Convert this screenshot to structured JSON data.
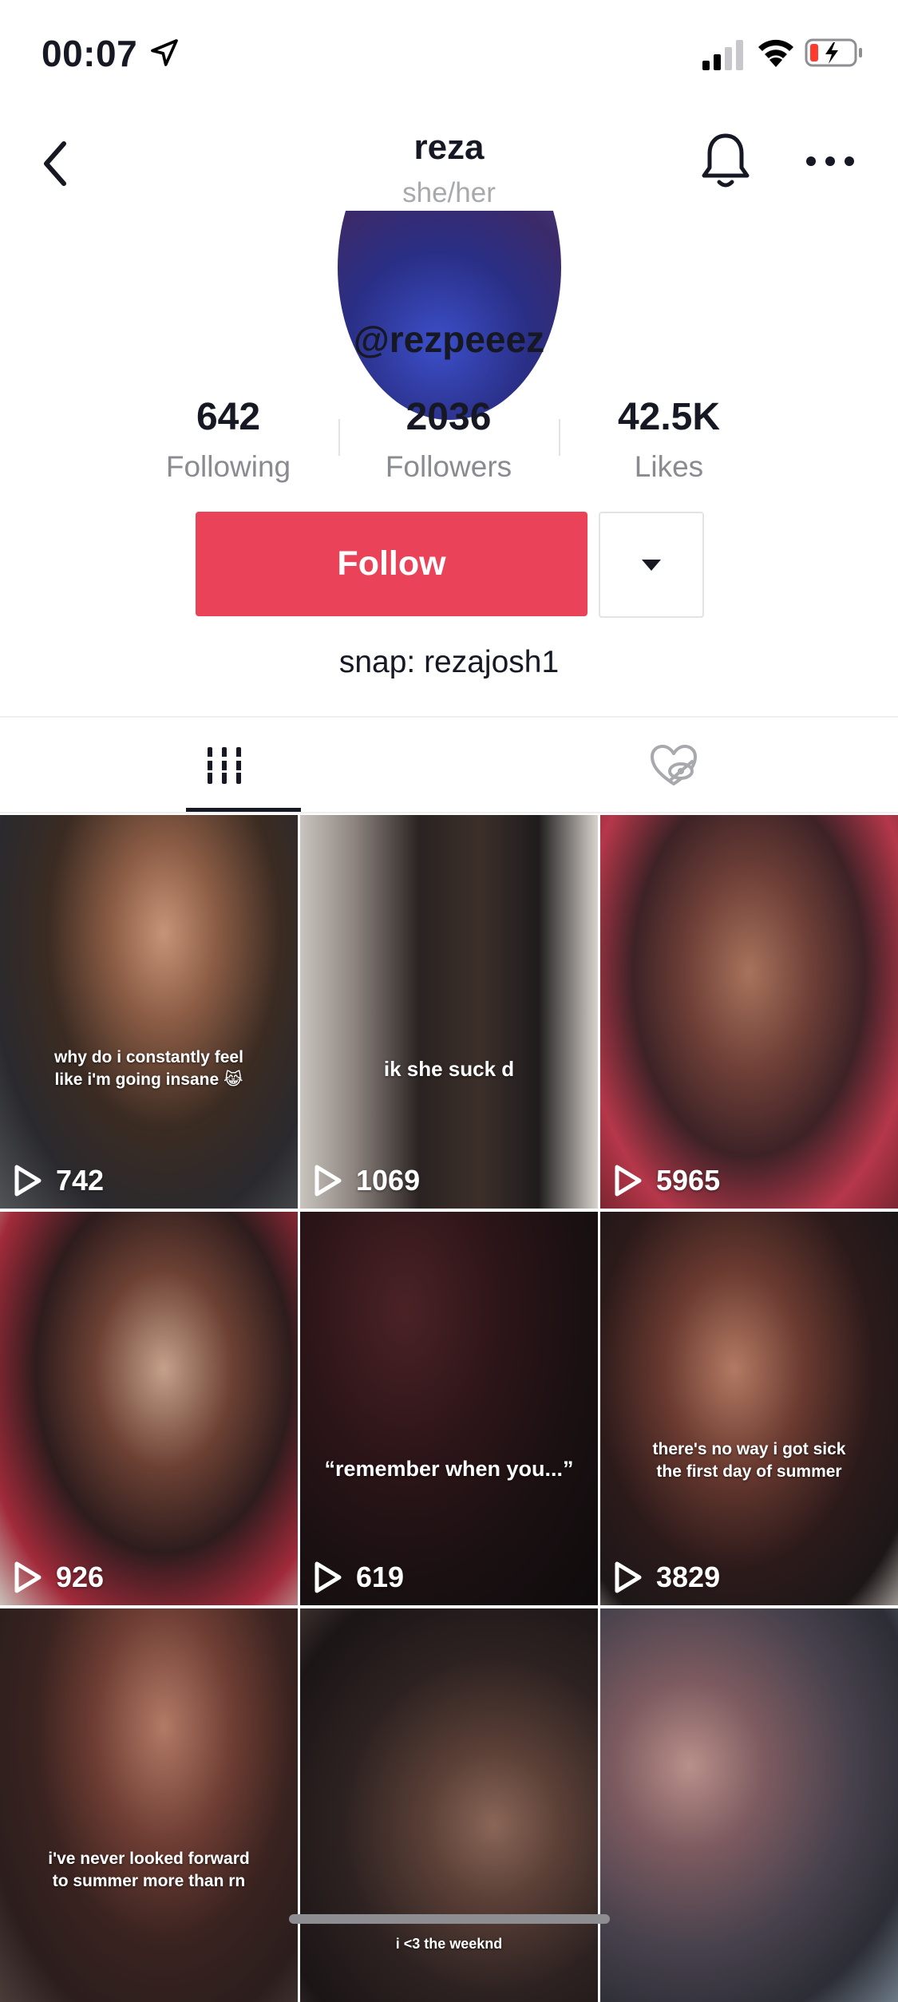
{
  "status_bar": {
    "time": "00:07"
  },
  "nav": {
    "title": "reza",
    "pronouns": "she/her"
  },
  "profile": {
    "handle": "@rezpeeez",
    "stats": [
      {
        "value": "642",
        "label": "Following"
      },
      {
        "value": "2036",
        "label": "Followers"
      },
      {
        "value": "42.5K",
        "label": "Likes"
      }
    ],
    "follow_label": "Follow",
    "bio": "snap: rezajosh1"
  },
  "tabs": {
    "active": "videos",
    "items": [
      "videos-grid-icon",
      "liked-hidden-icon"
    ]
  },
  "colors": {
    "follow": "#ea4359",
    "text": "#161823",
    "muted": "#8a8b91"
  },
  "videos": [
    {
      "views": "742",
      "caption": "why do i constantly feel\nlike i'm going insane 😹"
    },
    {
      "views": "1069",
      "caption": "ik she suck d"
    },
    {
      "views": "5965",
      "caption": ""
    },
    {
      "views": "926",
      "caption": ""
    },
    {
      "views": "619",
      "caption": "“remember when you...”"
    },
    {
      "views": "3829",
      "caption": "there's no way i got sick\nthe first day of summer"
    },
    {
      "views": "",
      "caption": "i've never looked forward\nto summer more than rn"
    },
    {
      "views": "",
      "caption": "i <3 the weeknd"
    },
    {
      "views": "",
      "caption": ""
    }
  ]
}
